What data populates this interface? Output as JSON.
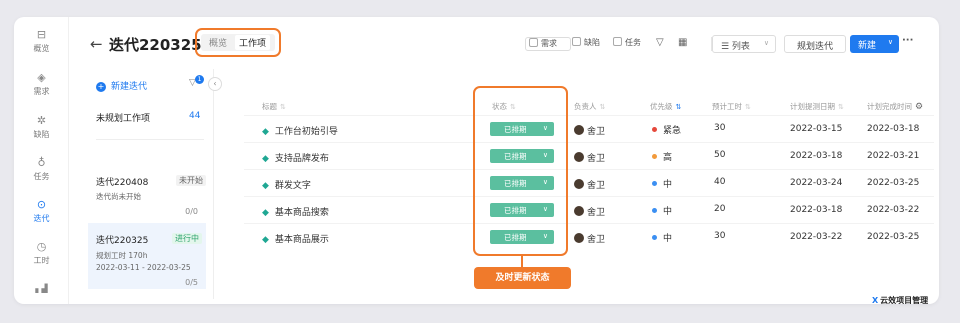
{
  "nav": [
    {
      "label": "概览",
      "icon": "overview-icon",
      "glyph": "⊟"
    },
    {
      "label": "需求",
      "icon": "layers-icon",
      "glyph": "◈"
    },
    {
      "label": "缺陷",
      "icon": "bug-icon",
      "glyph": "✲"
    },
    {
      "label": "任务",
      "icon": "bulb-icon",
      "glyph": "♁"
    },
    {
      "label": "迭代",
      "icon": "iteration-icon",
      "glyph": "⊙"
    },
    {
      "label": "工时",
      "icon": "clock-icon",
      "glyph": "◷"
    },
    {
      "label": "",
      "icon": "stats-icon",
      "glyph": "▖▟"
    }
  ],
  "header": {
    "back": "←",
    "title": "迭代220325",
    "tabs": [
      "概览",
      "工作项"
    ],
    "filters": [
      "需求",
      "缺陷",
      "任务"
    ],
    "list_view": "☰ 列表",
    "plan_button": "规划迭代",
    "new_button": "新建",
    "more": "···"
  },
  "iterations": {
    "new_label": "新建迭代",
    "filter_badge": "1",
    "unplanned_label": "未规划工作项",
    "unplanned_count": "44",
    "items": [
      {
        "name": "迭代220408",
        "status": "未开始",
        "sub": "迭代尚未开始",
        "dates": "",
        "count": "0/0"
      },
      {
        "name": "迭代220325",
        "status": "进行中",
        "sub": "规划工时 170h",
        "dates": "2022-03-11 - 2022-03-25",
        "count": "0/5"
      }
    ]
  },
  "table": {
    "headers": [
      "标题",
      "状态",
      "负责人",
      "优先级",
      "预计工时",
      "计划提测日期",
      "计划完成时间"
    ],
    "rows": [
      {
        "title": "工作台初始引导",
        "status": "已排期",
        "owner": "舍卫",
        "priority": "紧急",
        "priority_color": "#e5483b",
        "est": "30",
        "test_date": "2022-03-15",
        "done_date": "2022-03-18"
      },
      {
        "title": "支持品牌发布",
        "status": "已排期",
        "owner": "舍卫",
        "priority": "高",
        "priority_color": "#f29a3b",
        "est": "50",
        "test_date": "2022-03-18",
        "done_date": "2022-03-21"
      },
      {
        "title": "群发文字",
        "status": "已排期",
        "owner": "舍卫",
        "priority": "中",
        "priority_color": "#3b8ff2",
        "est": "40",
        "test_date": "2022-03-24",
        "done_date": "2022-03-25"
      },
      {
        "title": "基本商品搜索",
        "status": "已排期",
        "owner": "舍卫",
        "priority": "中",
        "priority_color": "#3b8ff2",
        "est": "20",
        "test_date": "2022-03-18",
        "done_date": "2022-03-22"
      },
      {
        "title": "基本商品展示",
        "status": "已排期",
        "owner": "舍卫",
        "priority": "中",
        "priority_color": "#3b8ff2",
        "est": "30",
        "test_date": "2022-03-22",
        "done_date": "2022-03-25"
      }
    ]
  },
  "callout": "及时更新状态",
  "brand": "云效项目管理",
  "colors": {
    "accent": "#1f7aef",
    "highlight": "#f07a2b",
    "status_green": "#5bbf9f"
  }
}
